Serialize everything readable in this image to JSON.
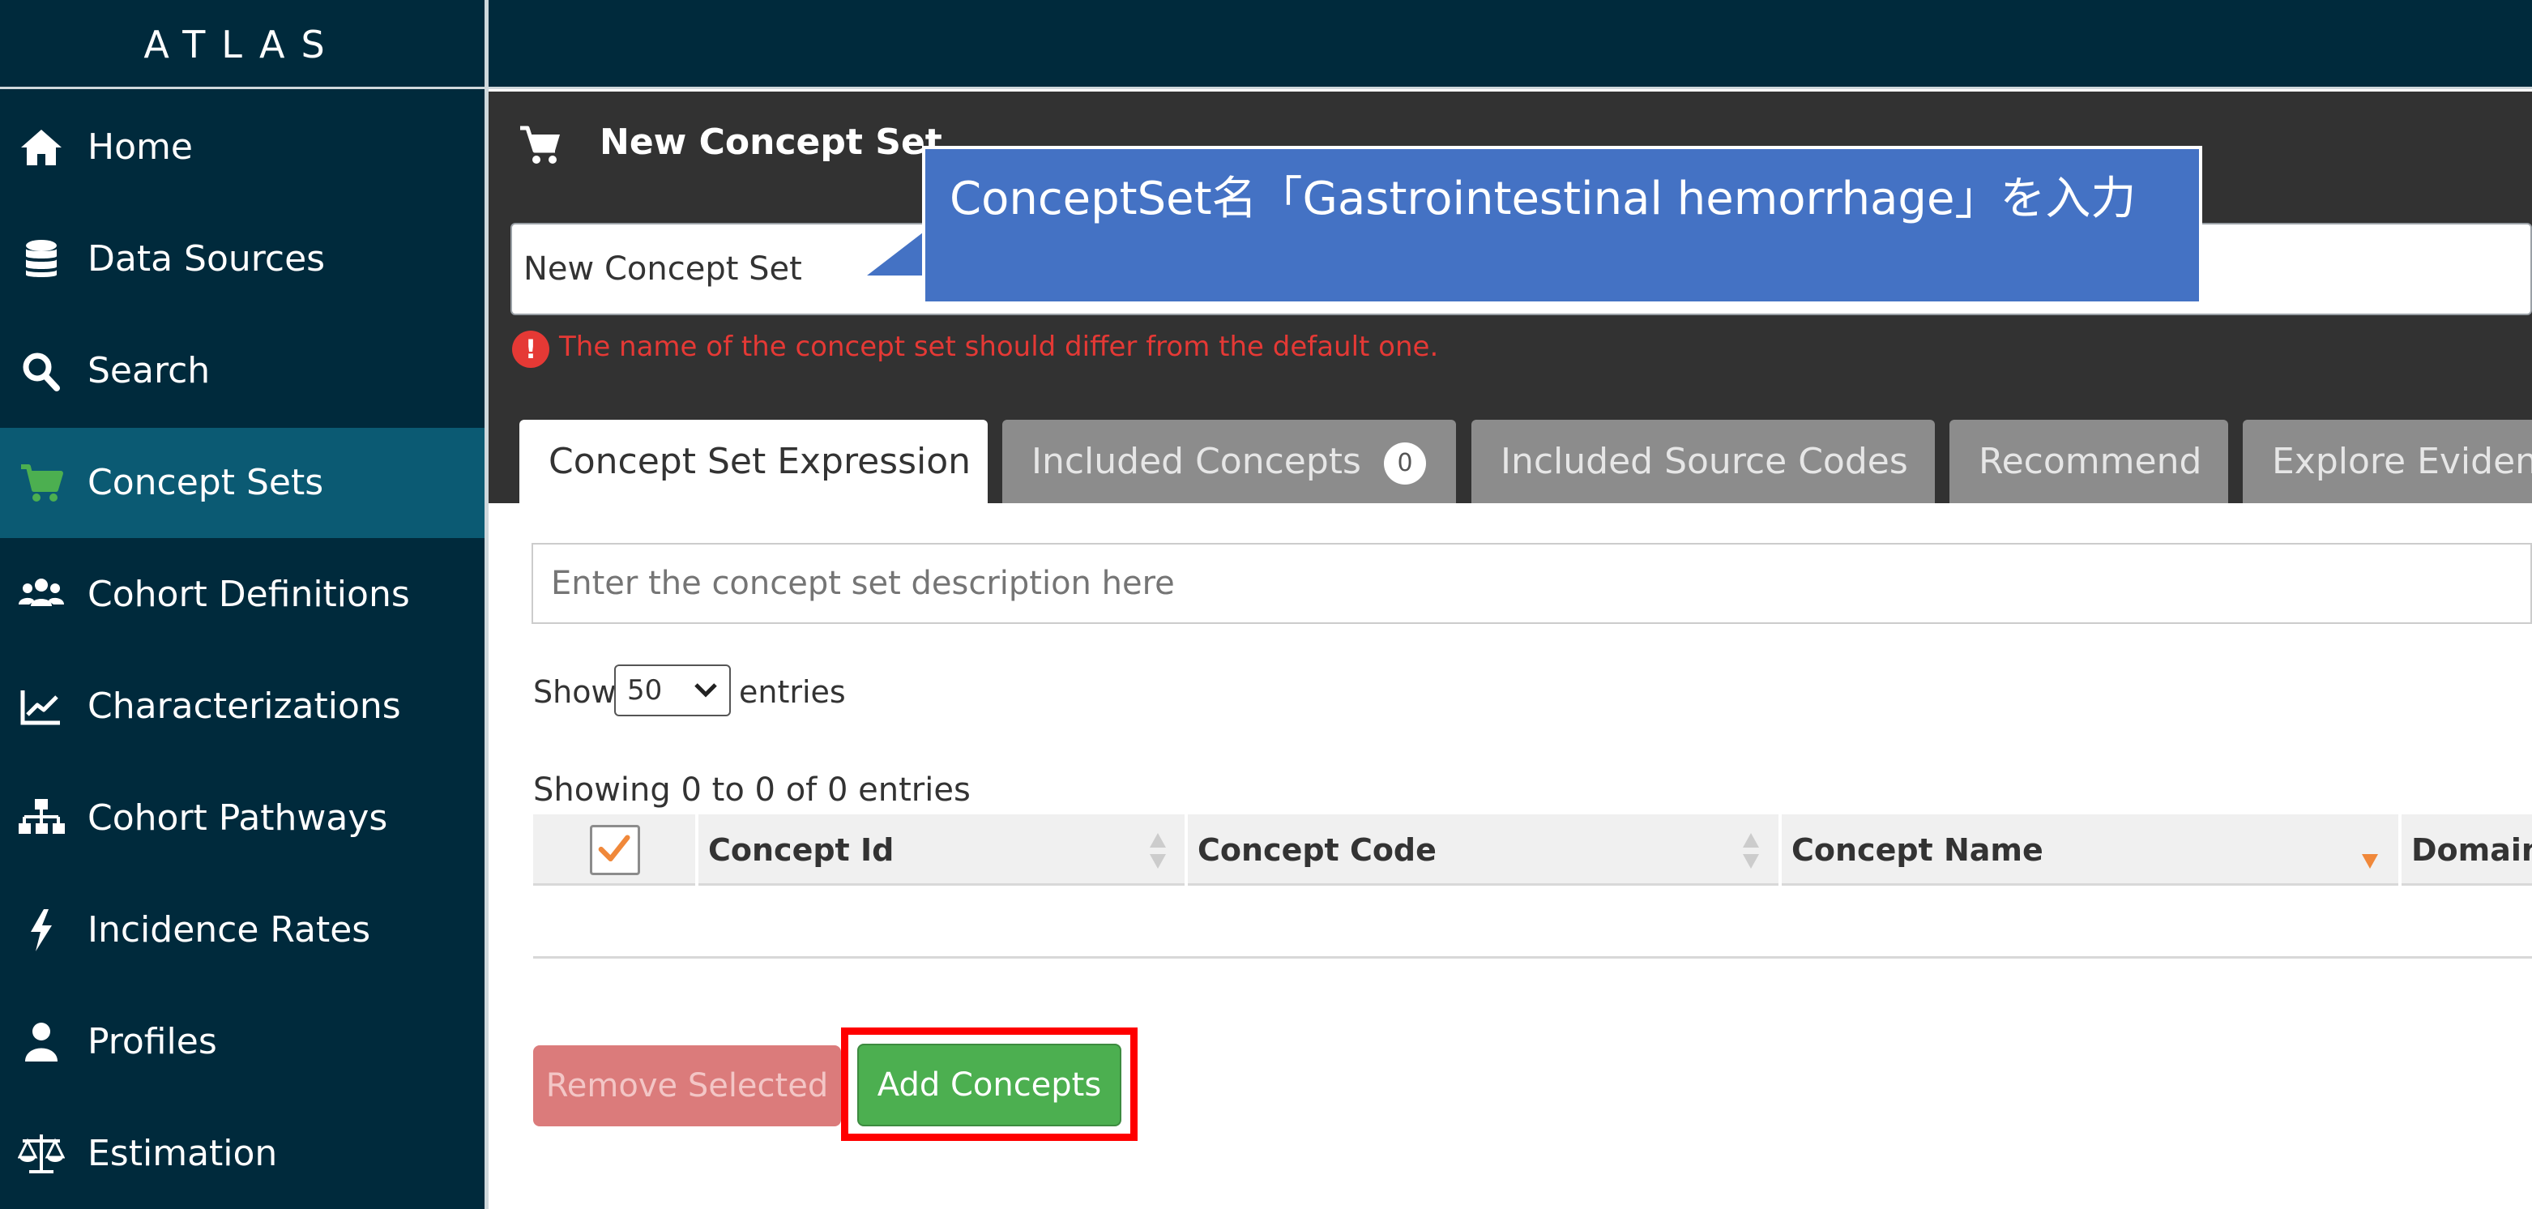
{
  "app": {
    "logo": "ATLAS"
  },
  "sidebar": {
    "items": [
      {
        "label": "Home",
        "icon": "home-icon"
      },
      {
        "label": "Data Sources",
        "icon": "database-icon"
      },
      {
        "label": "Search",
        "icon": "search-icon"
      },
      {
        "label": "Concept Sets",
        "icon": "cart-icon",
        "active": true
      },
      {
        "label": "Cohort Definitions",
        "icon": "users-icon"
      },
      {
        "label": "Characterizations",
        "icon": "line-chart-icon"
      },
      {
        "label": "Cohort Pathways",
        "icon": "sitemap-icon"
      },
      {
        "label": "Incidence Rates",
        "icon": "bolt-icon"
      },
      {
        "label": "Profiles",
        "icon": "user-icon"
      },
      {
        "label": "Estimation",
        "icon": "balance-scale-icon"
      }
    ]
  },
  "header": {
    "title": "New Concept Set",
    "name_value": "New Concept Set",
    "warning": "The name of the concept set should differ from the default one."
  },
  "tabs": [
    {
      "label": "Concept Set Expression",
      "active": true
    },
    {
      "label": "Included Concepts",
      "badge": "0"
    },
    {
      "label": "Included Source Codes"
    },
    {
      "label": "Recommend"
    },
    {
      "label": "Explore Eviden"
    }
  ],
  "callout": {
    "text": "ConceptSet名「Gastrointestinal hemorrhage」を入力"
  },
  "content": {
    "description_placeholder": "Enter the concept set description here",
    "show_label": "Show",
    "entries_value": "50",
    "entries_label": "entries",
    "showing_info": "Showing 0 to 0 of 0 entries",
    "columns": [
      "Concept Id",
      "Concept Code",
      "Concept Name",
      "Domain"
    ],
    "remove_button": "Remove Selected",
    "add_button": "Add Concepts"
  },
  "colors": {
    "sidebar_bg": "#002a3c",
    "active_nav": "#0b5a73",
    "header_bg": "#323232",
    "callout": "#4472c4",
    "warning": "#e53935",
    "add_button": "#4caf50",
    "highlight": "#ff0000",
    "sort_active": "#f0883a"
  }
}
